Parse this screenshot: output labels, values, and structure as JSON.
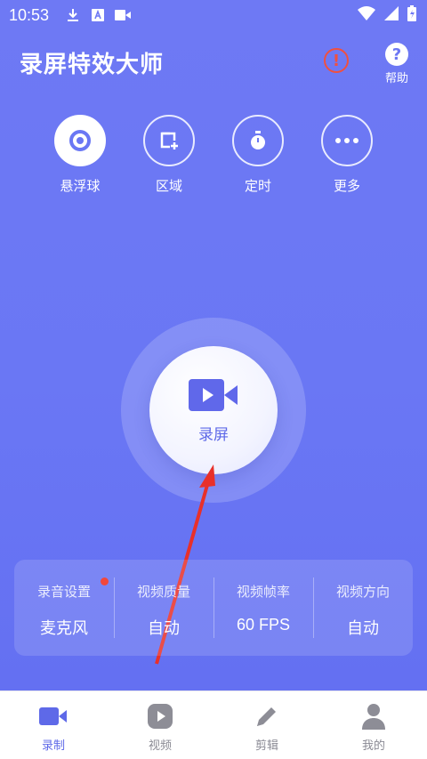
{
  "status_bar": {
    "time": "10:53"
  },
  "header": {
    "title": "录屏特效大师",
    "help_label": "帮助"
  },
  "tools": [
    {
      "label": "悬浮球",
      "icon": "floating-ball-icon"
    },
    {
      "label": "区域",
      "icon": "region-icon"
    },
    {
      "label": "定时",
      "icon": "timer-icon"
    },
    {
      "label": "更多",
      "icon": "more-icon"
    }
  ],
  "record": {
    "label": "录屏",
    "icon": "video-camera-icon"
  },
  "settings": [
    {
      "title": "录音设置",
      "value": "麦克风",
      "badge": true
    },
    {
      "title": "视频质量",
      "value": "自动"
    },
    {
      "title": "视频帧率",
      "value": "60 FPS"
    },
    {
      "title": "视频方向",
      "value": "自动"
    }
  ],
  "tabs": [
    {
      "label": "录制",
      "icon": "record-icon",
      "active": true
    },
    {
      "label": "视频",
      "icon": "play-icon"
    },
    {
      "label": "剪辑",
      "icon": "edit-pen-icon"
    },
    {
      "label": "我的",
      "icon": "profile-icon"
    }
  ],
  "colors": {
    "accent": "#6a77f4",
    "warning": "#f0503f",
    "badge": "#f2483c"
  }
}
